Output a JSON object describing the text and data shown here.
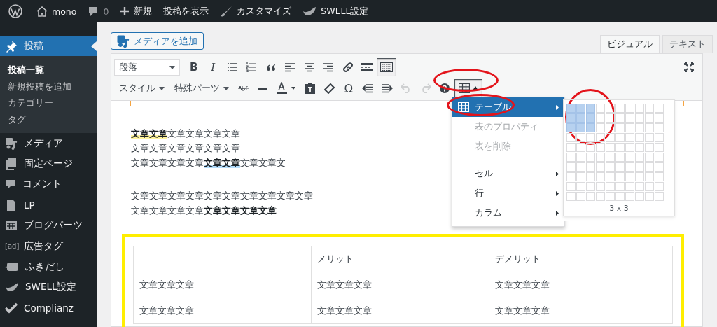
{
  "admin_bar": {
    "items": [
      {
        "kind": "wp-logo"
      },
      {
        "kind": "home",
        "label": "mono"
      },
      {
        "kind": "comments",
        "label": "0"
      },
      {
        "kind": "new",
        "label": "新規"
      },
      {
        "kind": "plain",
        "label": "投稿を表示"
      },
      {
        "kind": "brush",
        "label": "カスタマイズ"
      },
      {
        "kind": "bird",
        "label": "SWELL設定"
      }
    ]
  },
  "sidebar": {
    "items": [
      {
        "kind": "pin",
        "label": "投稿",
        "selected": true,
        "children": [
          {
            "label": "投稿一覧",
            "selected": true
          },
          {
            "label": "新規投稿を追加",
            "selected": false
          },
          {
            "label": "カテゴリー",
            "selected": false
          },
          {
            "label": "タグ",
            "selected": false
          }
        ]
      },
      {
        "kind": "media",
        "label": "メディア",
        "selected": false
      },
      {
        "kind": "pages",
        "label": "固定ページ",
        "selected": false
      },
      {
        "kind": "comment",
        "label": "コメント",
        "selected": false
      },
      {
        "kind": "page",
        "label": "LP",
        "selected": false
      },
      {
        "kind": "blocks",
        "label": "ブログパーツ",
        "selected": false
      },
      {
        "kind": "ad",
        "icon_text": "[ad]",
        "label": "広告タグ",
        "selected": false
      },
      {
        "kind": "balloon",
        "label": "ふきだし",
        "selected": false
      },
      {
        "kind": "bird",
        "label": "SWELL設定",
        "selected": false
      },
      {
        "kind": "check",
        "label": "Complianz",
        "selected": false
      }
    ]
  },
  "editor": {
    "add_media_button": "メディアを追加",
    "tabs": [
      {
        "label": "ビジュアル",
        "selected": true
      },
      {
        "label": "テキスト",
        "selected": false
      }
    ],
    "toolbar_row_1": [
      {
        "kind": "select",
        "label": "段落",
        "pressed": false
      },
      {
        "kind": "glyph-bold",
        "label": "B",
        "pressed": false
      },
      {
        "kind": "glyph-italic",
        "label": "I",
        "pressed": false
      },
      {
        "kind": "ul",
        "pressed": false
      },
      {
        "kind": "ol",
        "pressed": false
      },
      {
        "kind": "quote",
        "pressed": false
      },
      {
        "kind": "align-left",
        "pressed": false
      },
      {
        "kind": "align-center",
        "pressed": false
      },
      {
        "kind": "align-right",
        "pressed": false
      },
      {
        "kind": "link",
        "pressed": false
      },
      {
        "kind": "more",
        "pressed": false
      },
      {
        "kind": "toolbar-toggle",
        "pressed": true
      }
    ],
    "toolbar_row_2": [
      {
        "kind": "dropdown",
        "label": "スタイル",
        "pressed": false,
        "disabled": false
      },
      {
        "kind": "dropdown",
        "label": "特殊パーツ",
        "pressed": false,
        "disabled": false
      },
      {
        "kind": "strike",
        "pressed": false,
        "disabled": false
      },
      {
        "kind": "hr",
        "pressed": false,
        "disabled": false
      },
      {
        "kind": "text-color",
        "pressed": false,
        "disabled": false
      },
      {
        "kind": "paste",
        "pressed": false,
        "disabled": false
      },
      {
        "kind": "eraser",
        "pressed": false,
        "disabled": false
      },
      {
        "kind": "glyph",
        "label": "Ω",
        "pressed": false,
        "disabled": false
      },
      {
        "kind": "outdent",
        "pressed": false,
        "disabled": false
      },
      {
        "kind": "indent",
        "pressed": false,
        "disabled": false
      },
      {
        "kind": "undo",
        "pressed": false,
        "disabled": true
      },
      {
        "kind": "redo",
        "pressed": false,
        "disabled": true
      },
      {
        "kind": "help",
        "pressed": false,
        "disabled": false
      },
      {
        "kind": "table",
        "pressed": true,
        "disabled": false
      }
    ],
    "table_menu": {
      "items": [
        {
          "kind": "table-item",
          "label": "テーブル",
          "selected": true,
          "disabled": false,
          "submenu": true
        },
        {
          "kind": "item",
          "label": "表のプロパティ",
          "selected": false,
          "disabled": true,
          "submenu": false
        },
        {
          "kind": "item",
          "label": "表を削除",
          "selected": false,
          "disabled": true,
          "submenu": false
        },
        {
          "kind": "divider"
        },
        {
          "kind": "item",
          "label": "セル",
          "selected": false,
          "disabled": false,
          "submenu": true
        },
        {
          "kind": "item",
          "label": "行",
          "selected": false,
          "disabled": false,
          "submenu": true
        },
        {
          "kind": "item",
          "label": "カラム",
          "selected": false,
          "disabled": false,
          "submenu": true
        }
      ]
    },
    "grid_picker": {
      "label": "3 x 3",
      "rows": [
        {
          "cells": [
            {
              "selected": true
            },
            {
              "selected": true
            },
            {
              "selected": true
            },
            {
              "selected": false
            },
            {
              "selected": false
            },
            {
              "selected": false
            },
            {
              "selected": false
            },
            {
              "selected": false
            },
            {
              "selected": false
            },
            {
              "selected": false
            }
          ]
        },
        {
          "cells": [
            {
              "selected": true
            },
            {
              "selected": true
            },
            {
              "selected": true
            },
            {
              "selected": false
            },
            {
              "selected": false
            },
            {
              "selected": false
            },
            {
              "selected": false
            },
            {
              "selected": false
            },
            {
              "selected": false
            },
            {
              "selected": false
            }
          ]
        },
        {
          "cells": [
            {
              "selected": true
            },
            {
              "selected": true
            },
            {
              "selected": true
            },
            {
              "selected": false
            },
            {
              "selected": false
            },
            {
              "selected": false
            },
            {
              "selected": false
            },
            {
              "selected": false
            },
            {
              "selected": false
            },
            {
              "selected": false
            }
          ]
        },
        {
          "cells": [
            {
              "selected": false
            },
            {
              "selected": false
            },
            {
              "selected": false
            },
            {
              "selected": false
            },
            {
              "selected": false
            },
            {
              "selected": false
            },
            {
              "selected": false
            },
            {
              "selected": false
            },
            {
              "selected": false
            },
            {
              "selected": false
            }
          ]
        },
        {
          "cells": [
            {
              "selected": false
            },
            {
              "selected": false
            },
            {
              "selected": false
            },
            {
              "selected": false
            },
            {
              "selected": false
            },
            {
              "selected": false
            },
            {
              "selected": false
            },
            {
              "selected": false
            },
            {
              "selected": false
            },
            {
              "selected": false
            }
          ]
        },
        {
          "cells": [
            {
              "selected": false
            },
            {
              "selected": false
            },
            {
              "selected": false
            },
            {
              "selected": false
            },
            {
              "selected": false
            },
            {
              "selected": false
            },
            {
              "selected": false
            },
            {
              "selected": false
            },
            {
              "selected": false
            },
            {
              "selected": false
            }
          ]
        },
        {
          "cells": [
            {
              "selected": false
            },
            {
              "selected": false
            },
            {
              "selected": false
            },
            {
              "selected": false
            },
            {
              "selected": false
            },
            {
              "selected": false
            },
            {
              "selected": false
            },
            {
              "selected": false
            },
            {
              "selected": false
            },
            {
              "selected": false
            }
          ]
        },
        {
          "cells": [
            {
              "selected": false
            },
            {
              "selected": false
            },
            {
              "selected": false
            },
            {
              "selected": false
            },
            {
              "selected": false
            },
            {
              "selected": false
            },
            {
              "selected": false
            },
            {
              "selected": false
            },
            {
              "selected": false
            },
            {
              "selected": false
            }
          ]
        },
        {
          "cells": [
            {
              "selected": false
            },
            {
              "selected": false
            },
            {
              "selected": false
            },
            {
              "selected": false
            },
            {
              "selected": false
            },
            {
              "selected": false
            },
            {
              "selected": false
            },
            {
              "selected": false
            },
            {
              "selected": false
            },
            {
              "selected": false
            }
          ]
        },
        {
          "cells": [
            {
              "selected": false
            },
            {
              "selected": false
            },
            {
              "selected": false
            },
            {
              "selected": false
            },
            {
              "selected": false
            },
            {
              "selected": false
            },
            {
              "selected": false
            },
            {
              "selected": false
            },
            {
              "selected": false
            },
            {
              "selected": false
            }
          ]
        }
      ]
    },
    "paragraphs": [
      {
        "lines": [
          [
            {
              "text": "文章文章",
              "bold": true,
              "color": "#fff59d"
            },
            {
              "text": "文章文章文章文章",
              "bold": false
            }
          ],
          [
            {
              "text": "文章文章文章文章文章文章",
              "bold": false
            }
          ],
          [
            {
              "text": "文章文章文章文章",
              "bold": false
            },
            {
              "text": "文章文章",
              "bold": true,
              "color": "#b3dcfa"
            },
            {
              "text": "文章文章文",
              "bold": false
            }
          ]
        ]
      },
      {
        "lines": [
          [
            {
              "text": "文章文章文章文章文章文章文章文章文章文章",
              "bold": false
            }
          ],
          [
            {
              "text": "文章文章文章文章",
              "bold": false
            },
            {
              "text": "文章文章文章文章",
              "bold": true
            }
          ]
        ]
      }
    ],
    "table": {
      "rows": [
        [
          null,
          "メリット",
          "デメリット"
        ],
        [
          "文章文章文章",
          "文章文章文章",
          "文章文章文章"
        ],
        [
          "文章文章文章",
          "文章文章文章",
          "文章文章文章"
        ]
      ]
    }
  }
}
